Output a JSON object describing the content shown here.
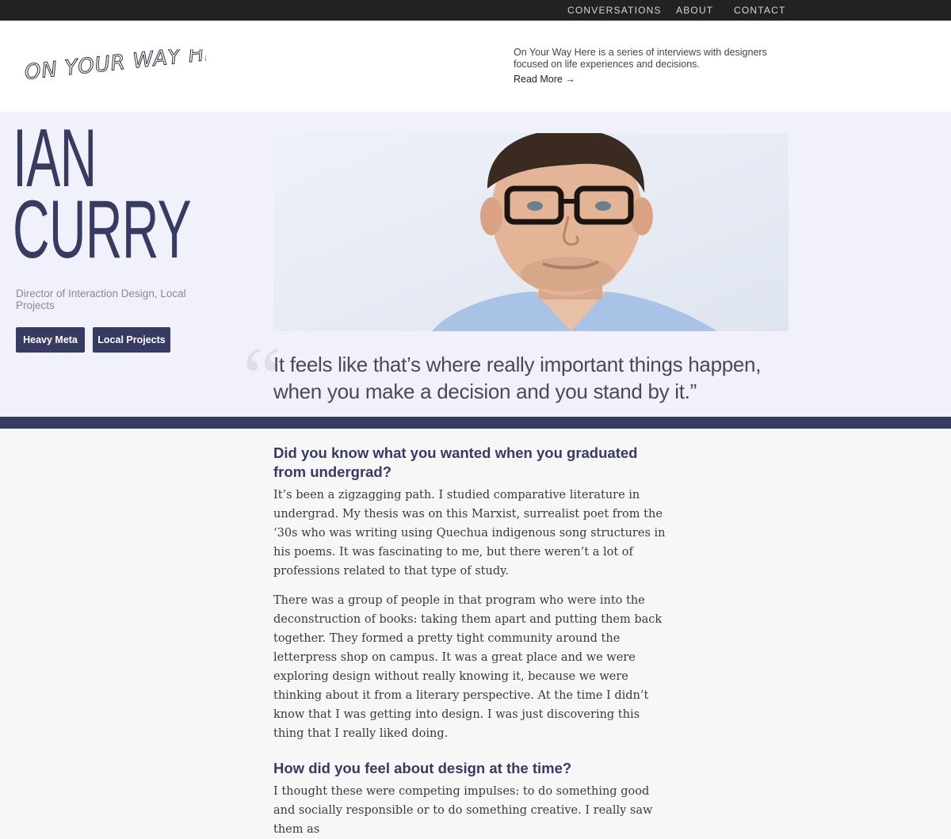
{
  "nav": {
    "conversations": "CONVERSATIONS",
    "about": "ABOUT",
    "contact": "CONTACT"
  },
  "header": {
    "logo_text": "ON YOUR WAY HERE",
    "tagline": "On Your Way Here is a series of interviews with designers focused on life experiences and decisions.",
    "read_more": "Read More →"
  },
  "profile": {
    "first_name": "IAN",
    "last_name": "CURRY",
    "role": "Director of Interaction Design, Local Projects",
    "tags": [
      "Heavy Meta",
      "Local Projects"
    ]
  },
  "quote": {
    "mark": "“",
    "text": "It feels like that’s where really important things happen, when you make a decision and you stand by it.”"
  },
  "article": {
    "q1": "Did you know what you wanted when you graduated from undergrad?",
    "p1": "It’s been a zigzagging path. I studied comparative literature in undergrad. My thesis was on this Marxist, surrealist poet from the ‘30s who was writing using Quechua indigenous song structures in his poems. It was fascinating to me, but there weren’t a lot of professions related to that type of study.",
    "p2": "There was a group of people in that program who were into the deconstruction of books: taking them apart and putting them back together. They formed a pretty tight community around the letterpress shop on campus. It was a great place and we were exploring design without really knowing it, because we were thinking about it from a literary perspective. At the time I didn’t know that I was getting into design. I was just discovering this thing that I really liked doing.",
    "q2": "How did you feel about design at the time?",
    "p3": "I thought these were competing impulses: to do something good and socially responsible or to do something creative. I really saw them as"
  },
  "colors": {
    "accent": "#373b62",
    "topbar": "#222222",
    "hero_bg": "#f1f1fb"
  }
}
